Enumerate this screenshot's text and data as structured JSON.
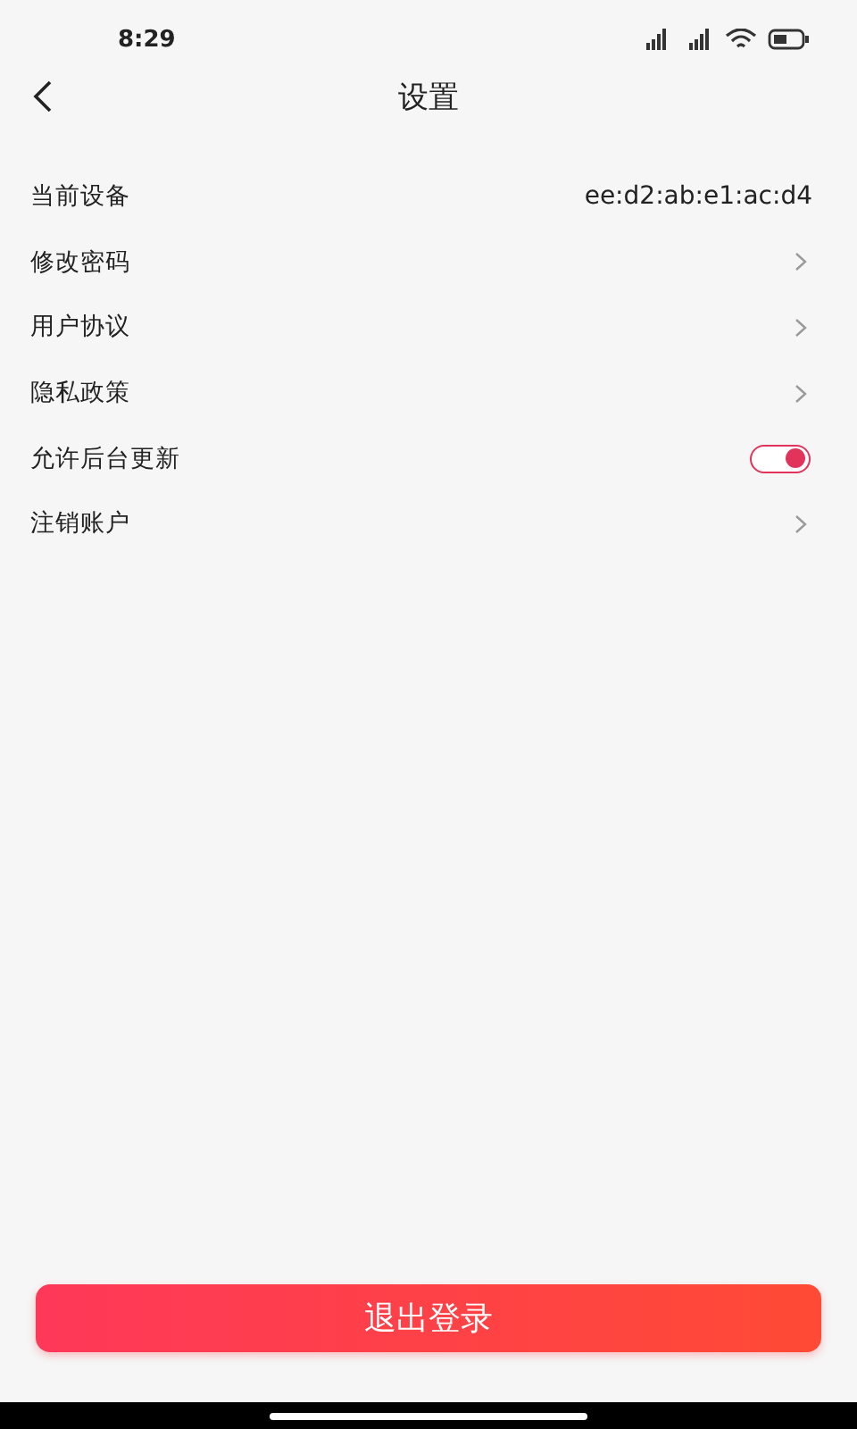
{
  "status_bar": {
    "time": "8:29"
  },
  "header": {
    "title": "设置"
  },
  "items": [
    {
      "kind": "value",
      "label": "当前设备",
      "value": "ee:d2:ab:e1:ac:d4"
    },
    {
      "kind": "link",
      "label": "修改密码"
    },
    {
      "kind": "link",
      "label": "用户协议"
    },
    {
      "kind": "link",
      "label": "隐私政策"
    },
    {
      "kind": "toggle",
      "label": "允许后台更新",
      "on": true
    },
    {
      "kind": "link",
      "label": "注销账户"
    }
  ],
  "logout_button": "退出登录"
}
